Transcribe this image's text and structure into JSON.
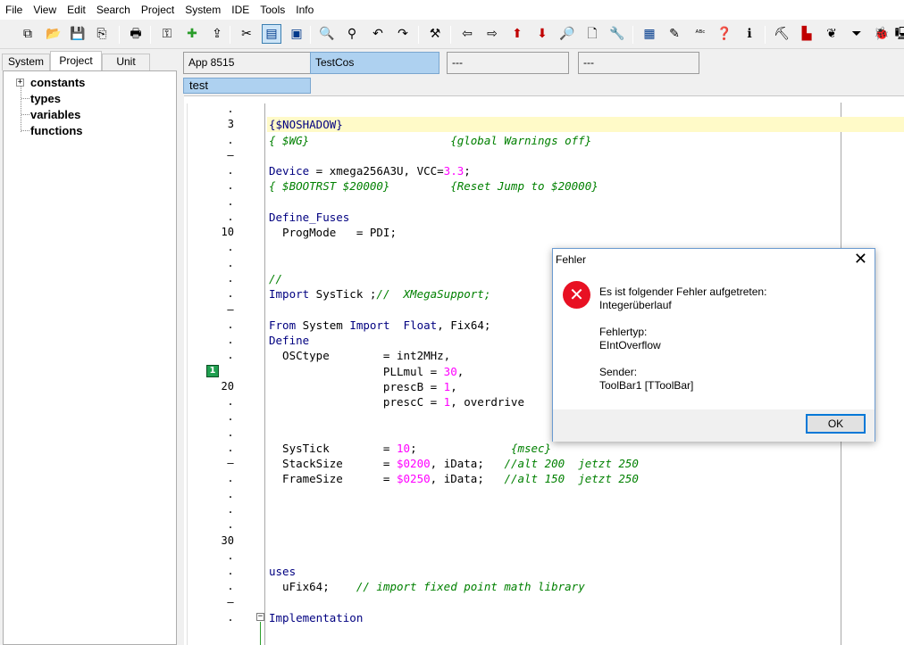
{
  "menu": [
    "File",
    "View",
    "Edit",
    "Search",
    "Project",
    "System",
    "IDE",
    "Tools",
    "Info"
  ],
  "toolbar": [
    {
      "icon": "copy-project-icon",
      "glyph": "⧉"
    },
    {
      "icon": "open-folder-icon",
      "glyph": "📂"
    },
    {
      "icon": "save-icon",
      "glyph": "💾"
    },
    {
      "icon": "save-all-icon",
      "glyph": "⎘"
    },
    {
      "icon": "print-icon",
      "glyph": "🖶"
    },
    {
      "icon": "key-icon",
      "glyph": "⚿"
    },
    {
      "icon": "add-folder-icon",
      "glyph": "✚"
    },
    {
      "icon": "folder-up-icon",
      "glyph": "⇪"
    },
    {
      "icon": "cut-icon",
      "glyph": "✂"
    },
    {
      "icon": "column-mode-icon",
      "glyph": "▤"
    },
    {
      "icon": "block-mode-icon",
      "glyph": "▣"
    },
    {
      "icon": "find-icon",
      "glyph": "🔍"
    },
    {
      "icon": "replace-icon",
      "glyph": "⚲"
    },
    {
      "icon": "undo-icon",
      "glyph": "↶"
    },
    {
      "icon": "redo-icon",
      "glyph": "↷"
    },
    {
      "icon": "hammer-icon",
      "glyph": "⚒"
    },
    {
      "icon": "arrow-left-icon",
      "glyph": "⇦"
    },
    {
      "icon": "arrow-right-icon",
      "glyph": "⇨"
    },
    {
      "icon": "arrow-up-red-icon",
      "glyph": "⬆"
    },
    {
      "icon": "arrow-down-red-icon",
      "glyph": "⬇"
    },
    {
      "icon": "preview-icon",
      "glyph": "🔎"
    },
    {
      "icon": "document-icon",
      "glyph": "🗋"
    },
    {
      "icon": "tools-icon",
      "glyph": "🔧"
    },
    {
      "icon": "calculator-icon",
      "glyph": "▦"
    },
    {
      "icon": "pencil-icon",
      "glyph": "✎"
    },
    {
      "icon": "spellcheck-icon",
      "glyph": "ᴬᴮᶜ"
    },
    {
      "icon": "help-pointer-icon",
      "glyph": "❓"
    },
    {
      "icon": "info-icon",
      "glyph": "ℹ"
    },
    {
      "icon": "pickaxe-icon",
      "glyph": "⛏"
    },
    {
      "icon": "bricks-icon",
      "glyph": "▙"
    },
    {
      "icon": "tree-icon",
      "glyph": "❦"
    },
    {
      "icon": "funnel-icon",
      "glyph": "⏷"
    },
    {
      "icon": "bug-icon",
      "glyph": "🐞"
    },
    {
      "icon": "terminal-icon",
      "glyph": "🖳"
    }
  ],
  "left_tabs": [
    "System",
    "Project",
    "Unit"
  ],
  "tree": [
    "constants",
    "types",
    "variables",
    "functions"
  ],
  "editor_tabs": [
    "App 8515",
    "TestCos",
    "---",
    "---"
  ],
  "sub_tab": "test",
  "gutter": [
    ".",
    "3",
    ".",
    "–",
    ".",
    ".",
    ".",
    ".",
    "10",
    ".",
    ".",
    ".",
    ".",
    "–",
    ".",
    ".",
    ".",
    "",
    "20",
    ".",
    ".",
    ".",
    ".",
    "–",
    ".",
    ".",
    ".",
    ".",
    "30",
    ".",
    ".",
    ".",
    "–",
    "."
  ],
  "code_lines": [
    [],
    [
      {
        "t": "{$NOSHADOW}",
        "c": "kw"
      }
    ],
    [
      {
        "t": "{ $WG}                     {global Warnings off}",
        "c": "cm"
      }
    ],
    [],
    [
      {
        "t": "Device",
        "c": "kw"
      },
      {
        "t": " = xmega256A3U, VCC=",
        "c": ""
      },
      {
        "t": "3.3",
        "c": "nm"
      },
      {
        "t": ";",
        "c": ""
      }
    ],
    [
      {
        "t": "{ $BOOTRST $20000}         {Reset Jump to $20000}",
        "c": "cm"
      }
    ],
    [],
    [
      {
        "t": "Define_Fuses",
        "c": "kw"
      }
    ],
    [
      {
        "t": "  ProgMode   = PDI;",
        "c": ""
      }
    ],
    [],
    [],
    [
      {
        "t": "//",
        "c": "cm"
      }
    ],
    [
      {
        "t": "Import",
        "c": "kw"
      },
      {
        "t": " SysTick ;",
        "c": ""
      },
      {
        "t": "//  XMegaSupport;",
        "c": "cm"
      }
    ],
    [],
    [
      {
        "t": "From",
        "c": "kw"
      },
      {
        "t": " System ",
        "c": ""
      },
      {
        "t": "Import",
        "c": "kw"
      },
      {
        "t": "  ",
        "c": ""
      },
      {
        "t": "Float",
        "c": "kw"
      },
      {
        "t": ", Fix64;",
        "c": ""
      }
    ],
    [
      {
        "t": "Define",
        "c": "kw"
      }
    ],
    [
      {
        "t": "  OSCtype        = int2MHz,",
        "c": ""
      }
    ],
    [
      {
        "t": "                 PLLmul = ",
        "c": ""
      },
      {
        "t": "30",
        "c": "nm"
      },
      {
        "t": ",",
        "c": ""
      }
    ],
    [
      {
        "t": "                 prescB = ",
        "c": ""
      },
      {
        "t": "1",
        "c": "nm"
      },
      {
        "t": ",",
        "c": ""
      }
    ],
    [
      {
        "t": "                 prescC = ",
        "c": ""
      },
      {
        "t": "1",
        "c": "nm"
      },
      {
        "t": ", overdrive",
        "c": ""
      }
    ],
    [],
    [],
    [
      {
        "t": "  SysTick        = ",
        "c": ""
      },
      {
        "t": "10",
        "c": "nm"
      },
      {
        "t": ";              ",
        "c": ""
      },
      {
        "t": "{msec}",
        "c": "cm"
      }
    ],
    [
      {
        "t": "  StackSize      = ",
        "c": ""
      },
      {
        "t": "$0200",
        "c": "nm"
      },
      {
        "t": ", iData;   ",
        "c": ""
      },
      {
        "t": "//alt 200  jetzt 250",
        "c": "cm"
      }
    ],
    [
      {
        "t": "  FrameSize      = ",
        "c": ""
      },
      {
        "t": "$0250",
        "c": "nm"
      },
      {
        "t": ", iData;   ",
        "c": ""
      },
      {
        "t": "//alt 150  jetzt 250",
        "c": "cm"
      }
    ],
    [],
    [],
    [],
    [],
    [],
    [
      {
        "t": "uses",
        "c": "kw"
      }
    ],
    [
      {
        "t": "  uFix64;    ",
        "c": ""
      },
      {
        "t": "// import fixed point math library",
        "c": "cm"
      }
    ],
    [],
    [
      {
        "t": "Implementation",
        "c": "kw"
      }
    ]
  ],
  "bookmark_label": "1",
  "dialog": {
    "title": "Fehler",
    "close": "✕",
    "icon_glyph": "✕",
    "line1": "Es ist folgender Fehler aufgetreten:",
    "line2": "Integerüberlauf",
    "type_label": "Fehlertyp:",
    "type_value": "EIntOverflow",
    "sender_label": "Sender:",
    "sender_value": "ToolBar1 [TToolBar]",
    "ok": "OK"
  }
}
